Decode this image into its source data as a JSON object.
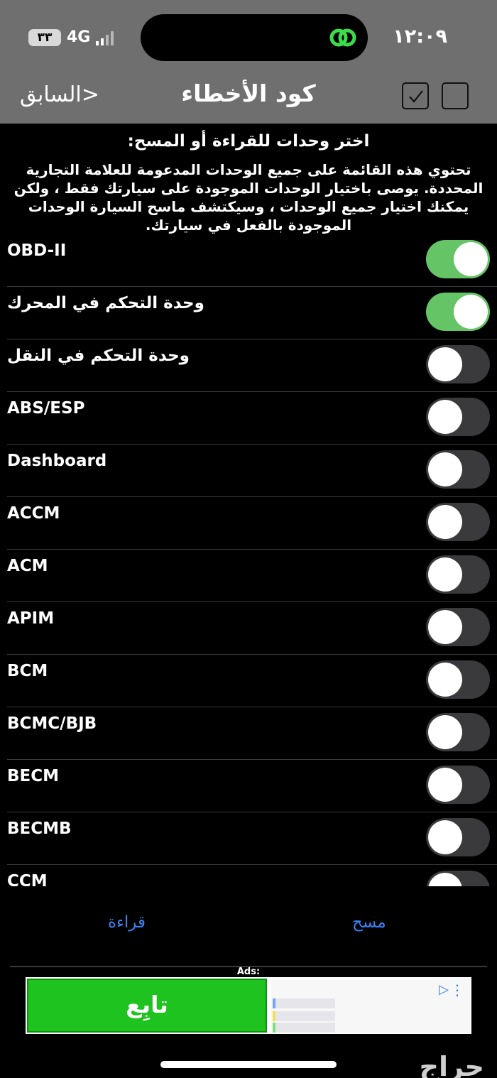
{
  "status": {
    "time": "١٢:٠٩",
    "battery": "٣٣",
    "network": "4G"
  },
  "nav": {
    "back_label": "<السابق",
    "title": "كود الأخطاء"
  },
  "intro": {
    "heading": "اختر وحدات للقراءة أو المسح:",
    "description": "تحتوي هذه القائمة على جميع الوحدات المدعومة للعلامة التجارية المحددة. يوصى باختيار الوحدات الموجودة على سيارتك فقط ، ولكن يمكنك اختيار جميع الوحدات ، وسيكتشف ماسح السيارة الوحدات الموجودة بالفعل في سيارتك."
  },
  "modules": [
    {
      "label": "OBD-II",
      "enabled": true
    },
    {
      "label": "وحدة التحكم في المحرك",
      "enabled": true
    },
    {
      "label": "وحدة التحكم في النقل",
      "enabled": false
    },
    {
      "label": "ABS/ESP",
      "enabled": false
    },
    {
      "label": "Dashboard",
      "enabled": false
    },
    {
      "label": "ACCM",
      "enabled": false
    },
    {
      "label": "ACM",
      "enabled": false
    },
    {
      "label": "APIM",
      "enabled": false
    },
    {
      "label": "BCM",
      "enabled": false
    },
    {
      "label": "BCMC/BJB",
      "enabled": false
    },
    {
      "label": "BECM",
      "enabled": false
    },
    {
      "label": "BECMB",
      "enabled": false
    },
    {
      "label": "CCM",
      "enabled": false
    }
  ],
  "actions": {
    "read_label": "قراءة",
    "scan_label": "مسح"
  },
  "ads": {
    "label": "Ads:",
    "button_label": "تابِع"
  },
  "watermark": "حراج",
  "colors": {
    "toggle_on": "#65c466",
    "toggle_off": "#3a3a3c",
    "action_blue": "#3b82f6",
    "header_gray": "#6f6f6f",
    "ad_green": "#1fc31f"
  }
}
